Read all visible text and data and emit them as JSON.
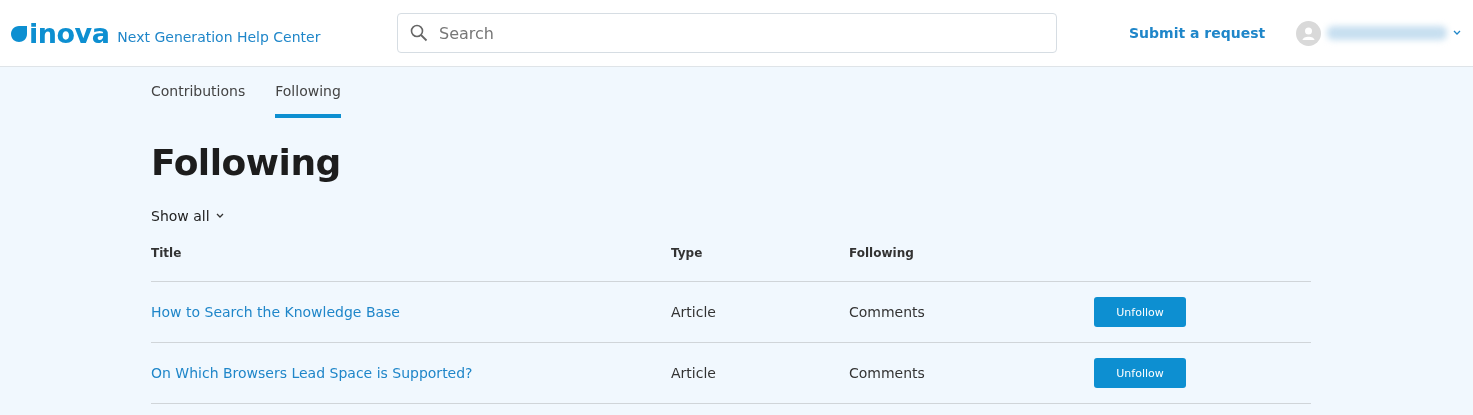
{
  "header": {
    "logo": "inova",
    "site_title": "Next Generation Help Center",
    "search": {
      "placeholder": "Search"
    },
    "submit_link": "Submit a request"
  },
  "tabs": [
    {
      "label": "Contributions",
      "selected": false
    },
    {
      "label": "Following",
      "selected": true
    }
  ],
  "heading": "Following",
  "filter": {
    "label": "Show all"
  },
  "table": {
    "columns": [
      "Title",
      "Type",
      "Following"
    ],
    "rows": [
      {
        "title": "How to Search the Knowledge Base",
        "type": "Article",
        "following": "Comments",
        "action": "Unfollow"
      },
      {
        "title": "On Which Browsers Lead Space is Supported?",
        "type": "Article",
        "following": "Comments",
        "action": "Unfollow"
      }
    ]
  }
}
